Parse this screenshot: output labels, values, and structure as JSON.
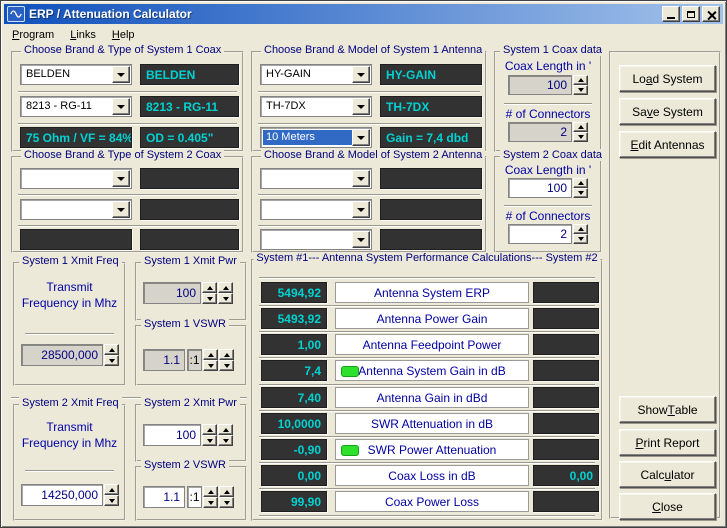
{
  "window": {
    "title": "ERP / Attenuation Calculator"
  },
  "menu": {
    "items": [
      {
        "label": "Program",
        "accel": 0
      },
      {
        "label": "Links",
        "accel": 0
      },
      {
        "label": "Help",
        "accel": 0
      }
    ]
  },
  "coax1": {
    "title": "Choose Brand & Type of System 1 Coax",
    "brand_combo": "BELDEN",
    "brand_display": "BELDEN",
    "model_combo": "8213 - RG-11",
    "model_display": "8213 - RG-11",
    "spec_left": "75 Ohm / VF = 84%",
    "spec_right": "OD = 0.405\""
  },
  "ant1": {
    "title": "Choose Brand & Model of System 1 Antenna",
    "brand_combo": "HY-GAIN",
    "brand_display": "HY-GAIN",
    "model_combo": "TH-7DX",
    "model_display": "TH-7DX",
    "band_combo": "10 Meters",
    "gain_display": "Gain = 7,4 dbd"
  },
  "coax1data": {
    "title": "System 1 Coax data",
    "length_label": "Coax Length in '",
    "length_value": "100",
    "connectors_label": "# of Connectors",
    "connectors_value": "2"
  },
  "coax2data": {
    "title": "System 2 Coax data",
    "length_label": "Coax Length in '",
    "length_value": "100",
    "connectors_label": "# of Connectors",
    "connectors_value": "2"
  },
  "coax2": {
    "title": "Choose Brand & Type of System 2 Coax",
    "brand_combo": "",
    "brand_display": "",
    "model_combo": "",
    "model_display": "",
    "spec_left": "",
    "spec_right": ""
  },
  "ant2": {
    "title": "Choose Brand & Model of System 2 Antenna",
    "brand_combo": "",
    "brand_display": "",
    "model_combo": "",
    "model_display": "",
    "band_combo": "",
    "gain_display": ""
  },
  "freq1": {
    "title": "System 1 Xmit Freq",
    "label_line1": "Transmit",
    "label_line2": "Frequency in Mhz",
    "value": "28500,000"
  },
  "pwr1": {
    "title": "System 1 Xmit Pwr",
    "value": "100"
  },
  "vswr1": {
    "title": "System 1 VSWR",
    "value": "1.1",
    "ratio_label": ":1"
  },
  "freq2": {
    "title": "System 2 Xmit Freq",
    "label_line1": "Transmit",
    "label_line2": "Frequency in Mhz",
    "value": "14250,000"
  },
  "pwr2": {
    "title": "System 2 Xmit Pwr",
    "value": "100"
  },
  "vswr2": {
    "title": "System 2 VSWR",
    "value": "1.1",
    "ratio_label": ":1"
  },
  "calc": {
    "title": "System #1--- Antenna System Performance Calculations--- System #2",
    "rows": [
      {
        "label": "Antenna System ERP",
        "s1": "5494,92",
        "s2": "",
        "led": false
      },
      {
        "label": "Antenna Power Gain",
        "s1": "5493,92",
        "s2": "",
        "led": false
      },
      {
        "label": "Antenna Feedpoint Power",
        "s1": "1,00",
        "s2": "",
        "led": false
      },
      {
        "label": "Antenna System Gain in dB",
        "s1": "7,4",
        "s2": "",
        "led": true
      },
      {
        "label": "Antenna Gain in dBd",
        "s1": "7,40",
        "s2": "",
        "led": false
      },
      {
        "label": "SWR Attenuation in dB",
        "s1": "10,0000",
        "s2": "",
        "led": false
      },
      {
        "label": "SWR Power Attenuation",
        "s1": "-0,90",
        "s2": "",
        "led": true
      },
      {
        "label": "Coax Loss in dB",
        "s1": "0,00",
        "s2": "0,00",
        "led": false
      },
      {
        "label": "Coax Power Loss",
        "s1": "99,90",
        "s2": "",
        "led": false
      }
    ]
  },
  "buttons": {
    "load": {
      "label": "Load System",
      "accel": 2
    },
    "save": {
      "label": "Save System",
      "accel": 2
    },
    "edit": {
      "label": "Edit Antennas",
      "accel": 0
    },
    "show_table": {
      "label": "Show Table",
      "accel": 5
    },
    "print": {
      "label": "Print Report",
      "accel": 0
    },
    "calculator": {
      "label": "Calculator",
      "accel": 4
    },
    "close": {
      "label": "Close",
      "accel": 0
    }
  },
  "colors": {
    "titlebar_left": "#0f50bc",
    "titlebar_right": "#a3c2ea",
    "window_bg": "#ECE9D8",
    "display_bg": "#323232",
    "display_text": "#00D2D2",
    "label_text": "#0000A0",
    "group_title": "#000080",
    "led_green": "#2CE02C",
    "selection_bg": "#316AC5"
  }
}
